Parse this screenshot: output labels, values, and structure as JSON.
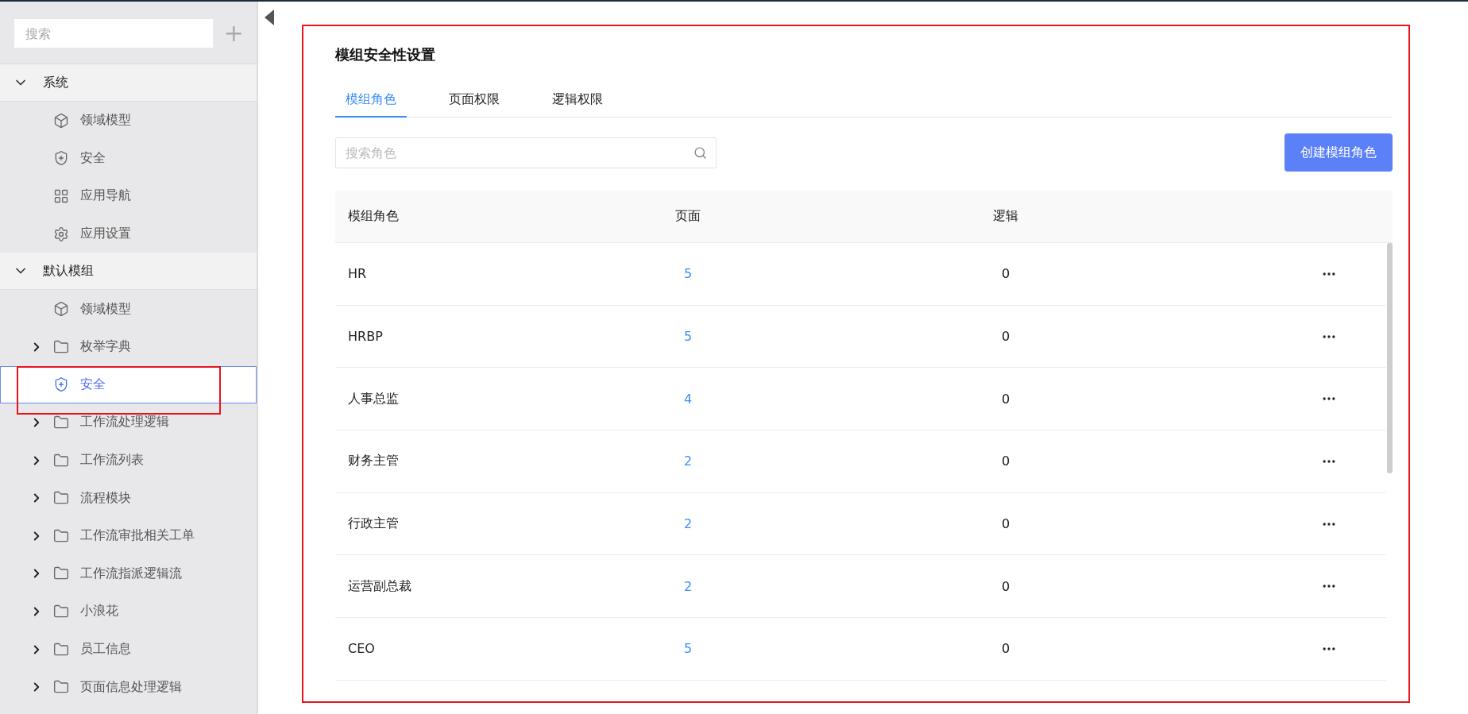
{
  "sidebar": {
    "search": {
      "placeholder": "搜索"
    },
    "add_button": "+",
    "groups": [
      {
        "label": "系统",
        "expanded": true,
        "children": [
          {
            "label": "领域模型",
            "kind": "cube",
            "selected": false
          },
          {
            "label": "安全",
            "kind": "shield",
            "selected": false
          },
          {
            "label": "应用导航",
            "kind": "grid",
            "selected": false
          },
          {
            "label": "应用设置",
            "kind": "gear",
            "selected": false
          }
        ]
      },
      {
        "label": "默认模组",
        "expanded": true,
        "children": [
          {
            "label": "领域模型",
            "kind": "cube",
            "selected": false
          },
          {
            "label": "枚举字典",
            "kind": "folder",
            "expanded": false,
            "selected": false
          },
          {
            "label": "安全",
            "kind": "shield",
            "selected": true
          },
          {
            "label": "工作流处理逻辑",
            "kind": "folder",
            "expanded": false,
            "selected": false
          },
          {
            "label": "工作流列表",
            "kind": "folder",
            "expanded": false,
            "selected": false
          },
          {
            "label": "流程模块",
            "kind": "folder",
            "expanded": false,
            "selected": false
          },
          {
            "label": "工作流审批相关工单",
            "kind": "folder",
            "expanded": false,
            "selected": false
          },
          {
            "label": "工作流指派逻辑流",
            "kind": "folder",
            "expanded": false,
            "selected": false
          },
          {
            "label": "小浪花",
            "kind": "folder",
            "expanded": false,
            "selected": false
          },
          {
            "label": "员工信息",
            "kind": "folder",
            "expanded": false,
            "selected": false
          },
          {
            "label": "页面信息处理逻辑",
            "kind": "folder",
            "expanded": false,
            "selected": false
          }
        ]
      }
    ]
  },
  "panel": {
    "title": "模组安全性设置",
    "tabs": [
      {
        "label": "模组角色",
        "selected": true
      },
      {
        "label": "页面权限",
        "selected": false
      },
      {
        "label": "逻辑权限",
        "selected": false
      }
    ],
    "search": {
      "placeholder": "搜索角色"
    },
    "create_button": "创建模组角色",
    "table": {
      "columns": [
        "模组角色",
        "页面",
        "逻辑"
      ],
      "rows": [
        {
          "role": "HR",
          "pages": "5",
          "logic": "0"
        },
        {
          "role": "HRBP",
          "pages": "5",
          "logic": "0"
        },
        {
          "role": "人事总监",
          "pages": "4",
          "logic": "0"
        },
        {
          "role": "财务主管",
          "pages": "2",
          "logic": "0"
        },
        {
          "role": "行政主管",
          "pages": "2",
          "logic": "0"
        },
        {
          "role": "运营副总裁",
          "pages": "2",
          "logic": "0"
        },
        {
          "role": "CEO",
          "pages": "5",
          "logic": "0"
        }
      ]
    }
  }
}
